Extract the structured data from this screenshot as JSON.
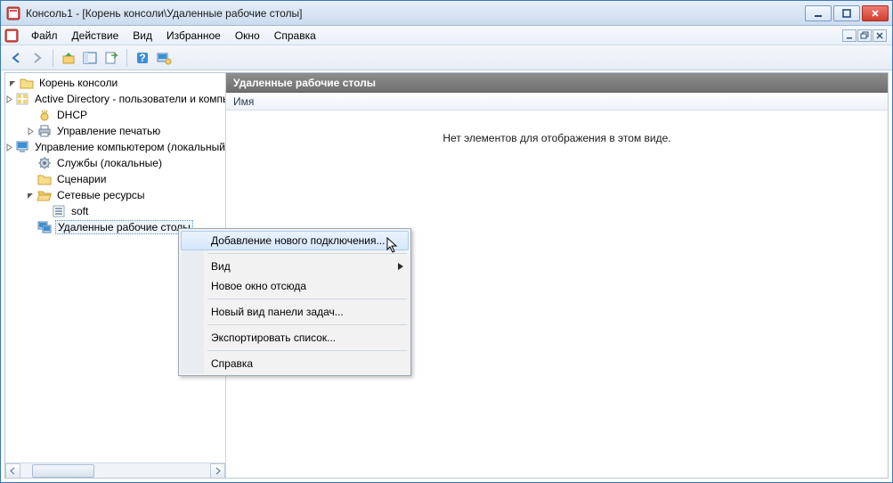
{
  "window": {
    "title": "Консоль1 - [Корень консоли\\Удаленные рабочие столы]"
  },
  "menubar": {
    "items": [
      "Файл",
      "Действие",
      "Вид",
      "Избранное",
      "Окно",
      "Справка"
    ]
  },
  "tree": {
    "root": "Корень консоли",
    "items": [
      {
        "label": "Active Directory - пользователи и компьютеры",
        "icon": "ad",
        "expander": "closed",
        "indent": 1
      },
      {
        "label": "DHCP",
        "icon": "dhcp",
        "expander": "none",
        "indent": 1
      },
      {
        "label": "Управление печатью",
        "icon": "print",
        "expander": "closed",
        "indent": 1
      },
      {
        "label": "Управление компьютером (локальный)",
        "icon": "computer",
        "expander": "closed",
        "indent": 1
      },
      {
        "label": "Службы (локальные)",
        "icon": "services",
        "expander": "none",
        "indent": 1
      },
      {
        "label": "Сценарии",
        "icon": "folder",
        "expander": "none",
        "indent": 1
      },
      {
        "label": "Сетевые ресурсы",
        "icon": "folder-open",
        "expander": "open",
        "indent": 1
      },
      {
        "label": "soft",
        "icon": "share",
        "expander": "none",
        "indent": 2
      },
      {
        "label": "Удаленные рабочие столы",
        "icon": "rdp",
        "expander": "none",
        "indent": 1,
        "selected": true
      }
    ]
  },
  "right": {
    "header": "Удаленные рабочие столы",
    "column": "Имя",
    "empty": "Нет элементов для отображения в этом виде."
  },
  "context": {
    "items": [
      {
        "label": "Добавление нового подключения...",
        "hover": true
      },
      {
        "sep": true
      },
      {
        "label": "Вид",
        "submenu": true
      },
      {
        "label": "Новое окно отсюда"
      },
      {
        "sep": true
      },
      {
        "label": "Новый вид панели задач..."
      },
      {
        "sep": true
      },
      {
        "label": "Экспортировать список..."
      },
      {
        "sep": true
      },
      {
        "label": "Справка"
      }
    ]
  }
}
